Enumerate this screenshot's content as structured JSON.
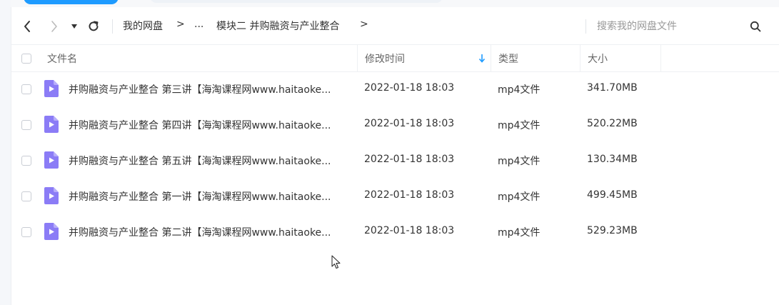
{
  "toolbar": {
    "back_icon": "chevron-left-icon",
    "forward_icon": "chevron-right-icon",
    "history_icon": "caret-down-icon",
    "refresh_icon": "refresh-icon"
  },
  "breadcrumb": {
    "root": "我的网盘",
    "sep": ">",
    "ellipsis": "...",
    "current": "模块二 并购融资与产业整合",
    "trailing_sep": ">"
  },
  "search": {
    "placeholder": "搜索我的网盘文件",
    "icon": "search-icon"
  },
  "table": {
    "columns": {
      "name": "文件名",
      "modified": "修改时间",
      "type": "类型",
      "size": "大小"
    },
    "sort_icon": "arrow-down-icon",
    "rows": [
      {
        "name": "并购融资与产业整合 第三讲【海淘课程网www.haitaoke...",
        "modified": "2022-01-18 18:03",
        "type": "mp4文件",
        "size": "341.70MB"
      },
      {
        "name": "并购融资与产业整合 第四讲【海淘课程网www.haitaoke...",
        "modified": "2022-01-18 18:03",
        "type": "mp4文件",
        "size": "520.22MB"
      },
      {
        "name": "并购融资与产业整合 第五讲【海淘课程网www.haitaoke...",
        "modified": "2022-01-18 18:03",
        "type": "mp4文件",
        "size": "130.34MB"
      },
      {
        "name": "并购融资与产业整合 第一讲【海淘课程网www.haitaoke...",
        "modified": "2022-01-18 18:03",
        "type": "mp4文件",
        "size": "499.45MB"
      },
      {
        "name": "并购融资与产业整合 第二讲【海淘课程网www.haitaoke...",
        "modified": "2022-01-18 18:03",
        "type": "mp4文件",
        "size": "529.23MB"
      }
    ]
  },
  "colors": {
    "accent": "#1e9bff",
    "video_icon": "#8b7cf6",
    "text": "#333333"
  }
}
